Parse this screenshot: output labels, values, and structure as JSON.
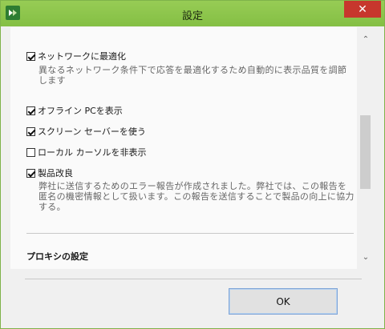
{
  "window": {
    "title": "設定",
    "close_symbol": "✕"
  },
  "options": [
    {
      "label": "ネットワークに最適化",
      "checked": true,
      "description": "異なるネットワーク条件下で応答を最適化するため自動的に表示品質を調節します"
    },
    {
      "label": "オフライン PCを表示",
      "checked": true
    },
    {
      "label": "スクリーン セーバーを使う",
      "checked": true
    },
    {
      "label": "ローカル カーソルを非表示",
      "checked": false
    },
    {
      "label": "製品改良",
      "checked": true,
      "description": "弊社に送信するためのエラー報告が作成されました。弊社では、この報告を匿名の機密情報として扱います。この報告を送信することで製品の向上に協力する。"
    }
  ],
  "section": {
    "title": "プロキシの設定"
  },
  "buttons": {
    "ok_label": "OK"
  },
  "icons": {
    "app": "app-logo-icon",
    "scroll_up": "chevron-up-icon",
    "scroll_down": "chevron-down-icon"
  }
}
